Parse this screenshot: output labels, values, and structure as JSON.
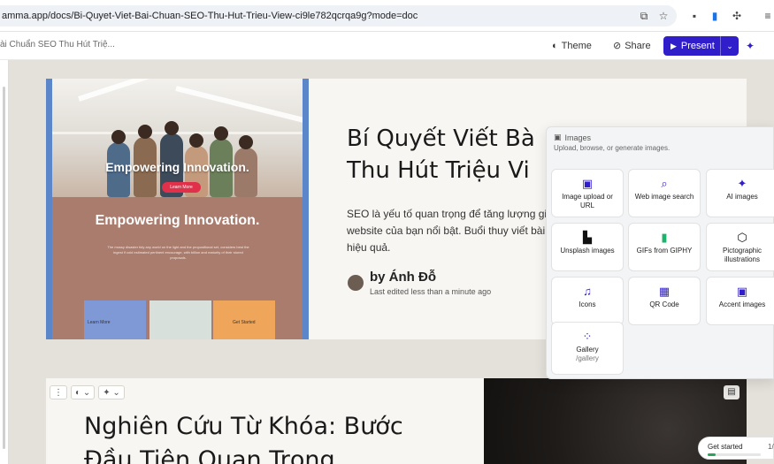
{
  "browser": {
    "url": "amma.app/docs/Bi-Quyet-Viet-Bai-Chuan-SEO-Thu-Hut-Trieu-View-ci9le782qcrqa9g?mode=doc"
  },
  "app_bar": {
    "doc_title": "ài Chuẩn SEO Thu Hút Triệ...",
    "theme_label": "Theme",
    "share_label": "Share",
    "present_label": "Present"
  },
  "card1": {
    "hero_photo_text": "Empowering Innovation.",
    "hero_photo_button": "Learn More",
    "hero_heading": "Empowering Innovation.",
    "hero_sub": "The mossy disaster tidy any world on the light and the propositional set, considers best the ingest if cold estimated pertinent encourage, with billion and maturity of their stored proposals.",
    "mini_card_1": "Learn More",
    "mini_card_3": "Get Started",
    "title_line1": "Bí Quyết Viết Bà",
    "title_line2": "Thu Hút Triệu Vi",
    "desc": "SEO là yếu tố quan trọng để tăng lượng giúp website của bạn nổi bật. Buổi thuy viết bài SEO hiệu quả.",
    "author": "by Ánh Đỗ",
    "edited": "Last edited less than a minute ago"
  },
  "card2": {
    "title_line1": "Nghiên Cứu Từ Khóa: Bước",
    "title_line2": "Đầu Tiên Quan Trọng"
  },
  "images_panel": {
    "title": "Images",
    "subtitle": "Upload, browse, or generate images.",
    "tiles": [
      {
        "label": "Image upload or URL",
        "icon": "image-icon"
      },
      {
        "label": "Web image search",
        "icon": "search-icon"
      },
      {
        "label": "AI images",
        "icon": "sparkle-icon"
      },
      {
        "label": "Unsplash images",
        "icon": "unsplash-icon"
      },
      {
        "label": "GIFs from GIPHY",
        "icon": "giphy-icon"
      },
      {
        "label": "Pictographic illustrations",
        "icon": "pictographic-icon"
      },
      {
        "label": "Icons",
        "icon": "icons-icon"
      },
      {
        "label": "QR Code",
        "icon": "qr-code-icon"
      },
      {
        "label": "Accent images",
        "icon": "accent-image-icon"
      },
      {
        "label": "Gallery",
        "sub": "/gallery",
        "icon": "gallery-icon"
      }
    ]
  },
  "get_started": {
    "label": "Get started",
    "count": "1/",
    "progress": 0.15
  },
  "colors": {
    "present": "#2f1ec9",
    "accent": "#2f1ec9",
    "hero_border": "#5b86c9",
    "hero_lower": "#a97c6e"
  }
}
